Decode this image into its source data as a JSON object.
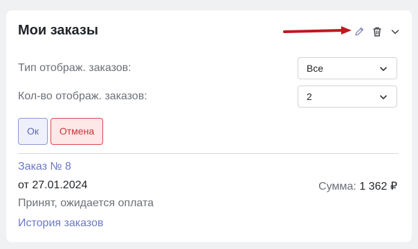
{
  "widget": {
    "title": "Мои заказы",
    "icons": {
      "edit": "pencil-icon",
      "delete": "trash-icon",
      "collapse": "chevron-down-icon"
    }
  },
  "settings": {
    "display_type": {
      "label": "Тип отображ. заказов:",
      "value": "Все"
    },
    "display_count": {
      "label": "Кол-во отображ. заказов:",
      "value": "2"
    }
  },
  "buttons": {
    "ok_label": "Ок",
    "cancel_label": "Отмена"
  },
  "order": {
    "link_label": "Заказ № 8",
    "date": "от 27.01.2024",
    "sum_label": "Сумма:",
    "sum_value": "1 362 ₽",
    "status": "Принят, ожидается оплата"
  },
  "history_link": "История заказов",
  "colors": {
    "arrow": "#c0181c",
    "link": "#6b78c4",
    "ok_border": "#8d97d2",
    "cancel_border": "#d9464a"
  }
}
